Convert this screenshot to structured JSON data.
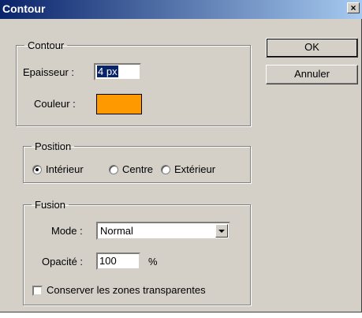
{
  "window": {
    "title": "Contour",
    "close_glyph": "×"
  },
  "contour_group": {
    "legend": "Contour",
    "thickness_label": "Epaisseur :",
    "thickness_value": "4 px",
    "color_label": "Couleur :",
    "color_hex": "#ff9900"
  },
  "position_group": {
    "legend": "Position",
    "options": [
      {
        "label": "Intérieur",
        "checked": true
      },
      {
        "label": "Centre",
        "checked": false
      },
      {
        "label": "Extérieur",
        "checked": false
      }
    ]
  },
  "fusion_group": {
    "legend": "Fusion",
    "mode_label": "Mode :",
    "mode_value": "Normal",
    "opacity_label": "Opacité :",
    "opacity_value": "100",
    "opacity_unit": "%",
    "preserve_transparency_label": "Conserver les zones transparentes",
    "preserve_transparency_checked": false
  },
  "buttons": {
    "ok": "OK",
    "cancel": "Annuler"
  },
  "colors": {
    "face": "#d4d0c8",
    "title_start": "#0a246a",
    "title_end": "#a6caf0",
    "selection": "#0a246a"
  }
}
